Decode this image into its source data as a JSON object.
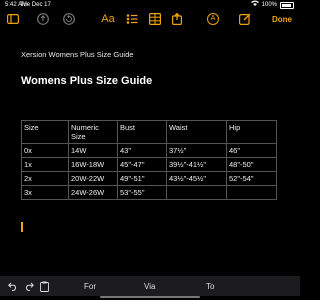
{
  "status_bar": {
    "time": "5:42 AM",
    "date": "Tue Dec 17",
    "battery": "100%"
  },
  "toolbar": {
    "format_label": "Aa",
    "done_label": "Done",
    "icons": [
      "sidebar-icon",
      "share-icon",
      "undo-icon",
      "format-icon",
      "checklist-icon",
      "table-icon",
      "camera-icon",
      "markup-icon",
      "share-note-icon",
      "more-icon"
    ]
  },
  "document": {
    "subtitle": "Xersion Womens Plus Size Guide",
    "heading": "Womens Plus Size Guide",
    "table": {
      "headers": [
        "Size",
        "Numeric Size",
        "Bust",
        "Waist",
        "Hip"
      ],
      "rows": [
        [
          "0x",
          "14W",
          "43\"",
          "37½\"",
          "46\""
        ],
        [
          "1x",
          "16W-18W",
          "45\"-47\"",
          "39½\"-41½\"",
          "48\"-50\""
        ],
        [
          "2x",
          "20W-22W",
          "49\"-51\"",
          "43½\"-45½\"",
          "52\"-54\""
        ],
        [
          "3x",
          "24W-26W",
          "53\"-55\"",
          "",
          ""
        ]
      ]
    }
  },
  "keyboard_bar": {
    "suggestions": [
      "For",
      "Via",
      "To"
    ]
  },
  "colors": {
    "accent": "#f0a30a",
    "background": "#000000"
  }
}
